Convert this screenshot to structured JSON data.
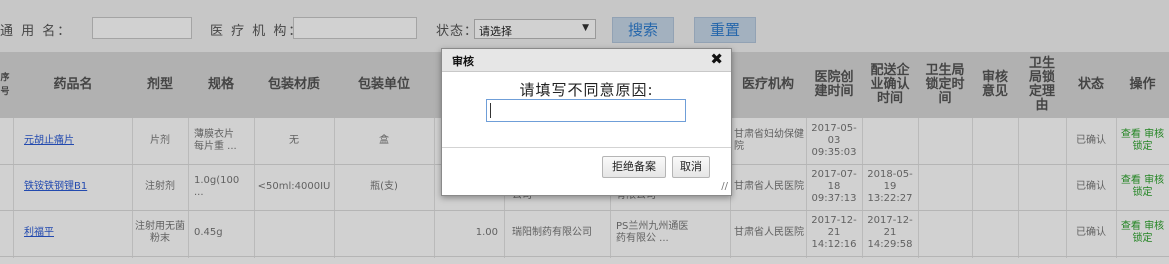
{
  "filters": {
    "common_name_label": "通 用 名：",
    "institution_label": "医 疗 机 构：",
    "status_label": "状态：",
    "status_value": "请选择",
    "search_button": "搜索",
    "reset_button": "重置"
  },
  "table": {
    "left_edge_header": "序\n号",
    "headers": {
      "drug_name": "药品名",
      "dosage_form": "剂型",
      "spec": "规格",
      "pkg_material": "包装材质",
      "pkg_unit": "包装单位",
      "institution": "医疗机构",
      "hospital_created": "医院创\n建时间",
      "delivery_confirm": "配送企\n业确认\n时间",
      "health_lock": "卫生局\n锁定时\n间",
      "review_opinion": "审核\n意见",
      "health_lock_reason": "卫生\n局锁\n定理\n由",
      "status": "状态",
      "action": "操作"
    },
    "rows": [
      {
        "drug_name": "元胡止痛片",
        "dosage_form": "片剂",
        "spec": "薄膜衣片\n每片重 ...",
        "pkg_material": "无",
        "pkg_unit": "盒",
        "qty": "",
        "manufacturer": "",
        "distributor": "",
        "institution": "甘肃省妇幼保健院",
        "hospital_created": "2017-05-\n03\n09:35:03",
        "delivery_confirm": "",
        "status": "已确认",
        "view": "查看",
        "review": "审核",
        "lock": "锁定"
      },
      {
        "drug_name": "铁铵铁钢锂B1",
        "dosage_form": "注射剂",
        "spec": "1.0g(100\n...",
        "pkg_material": "<50ml:4000IU",
        "pkg_unit": "瓶(支)",
        "qty": "",
        "manufacturer": "公司",
        "distributor": "有限公司",
        "institution": "甘肃省人民医院",
        "hospital_created": "2017-07-\n18\n09:37:13",
        "delivery_confirm": "2018-05-\n19\n13:22:27",
        "status": "已确认",
        "view": "查看",
        "review": "审核",
        "lock": "锁定"
      },
      {
        "drug_name": "利福平",
        "dosage_form": "注射用无菌\n粉末",
        "spec": "0.45g",
        "pkg_material": "",
        "pkg_unit": "",
        "qty": "1.00",
        "manufacturer": "瑞阳制药有限公司",
        "distributor": "PS兰州九州通医\n药有限公 ...",
        "institution": "甘肃省人民医院",
        "hospital_created": "2017-12-\n21\n14:12:16",
        "delivery_confirm": "2017-12-\n21\n14:29:58",
        "status": "已确认",
        "view": "查看",
        "review": "审核",
        "lock": "锁定"
      }
    ]
  },
  "modal": {
    "title": "审核",
    "close_glyph": "✖",
    "prompt": "请填写不同意原因:",
    "input_value": "",
    "reject_button": "拒绝备案",
    "cancel_button": "取消",
    "resize_glyph": "//"
  }
}
